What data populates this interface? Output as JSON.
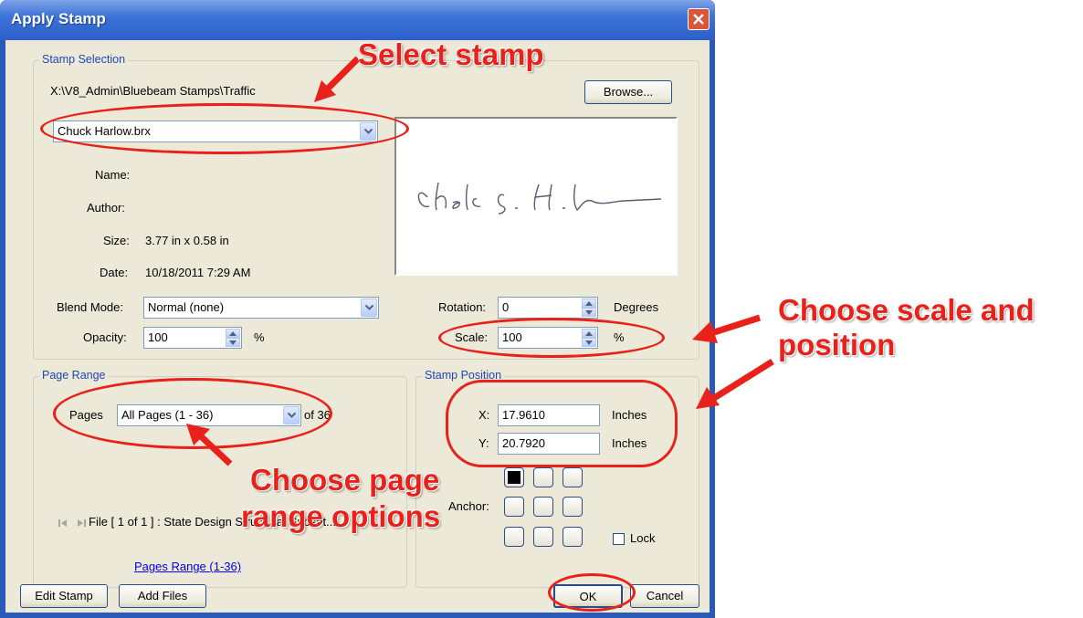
{
  "window": {
    "title": "Apply Stamp"
  },
  "stamp_selection": {
    "legend": "Stamp Selection",
    "path": "X:\\V8_Admin\\Bluebeam Stamps\\Traffic",
    "browse_label": "Browse...",
    "stamp_value": "Chuck Harlow.brx",
    "name_label": "Name:",
    "name_value": "",
    "author_label": "Author:",
    "author_value": "",
    "size_label": "Size:",
    "size_value": "3.77 in x 0.58 in",
    "date_label": "Date:",
    "date_value": "10/18/2011  7:29 AM",
    "blend_label": "Blend Mode:",
    "blend_value": "Normal (none)",
    "opacity_label": "Opacity:",
    "opacity_value": "100",
    "opacity_unit": "%",
    "rotation_label": "Rotation:",
    "rotation_value": "0",
    "rotation_unit": "Degrees",
    "scale_label": "Scale:",
    "scale_value": "100",
    "scale_unit": "%"
  },
  "page_range": {
    "legend": "Page Range",
    "pages_label": "Pages",
    "pages_value": "All Pages (1 - 36)",
    "of_text": "of 36",
    "file_text": "File [ 1 of 1 ] :  State Design Structural Subset...",
    "pages_range_link": "Pages Range (1-36)"
  },
  "stamp_position": {
    "legend": "Stamp Position",
    "x_label": "X:",
    "x_value": "17.9610",
    "x_unit": "Inches",
    "y_label": "Y:",
    "y_value": "20.7920",
    "y_unit": "Inches",
    "anchor_label": "Anchor:",
    "lock_label": "Lock"
  },
  "buttons": {
    "edit_stamp": "Edit Stamp",
    "add_files": "Add Files",
    "ok": "OK",
    "cancel": "Cancel"
  },
  "annotations": {
    "select_stamp": "Select stamp",
    "choose_scale_line1": "Choose scale and",
    "choose_scale_line2": "position",
    "choose_page_line1": "Choose page",
    "choose_page_line2": "range options"
  },
  "colors": {
    "annotation_red": "#e8211a",
    "title_blue": "#2c5fc8",
    "dialog_bg": "#ece9d8"
  }
}
